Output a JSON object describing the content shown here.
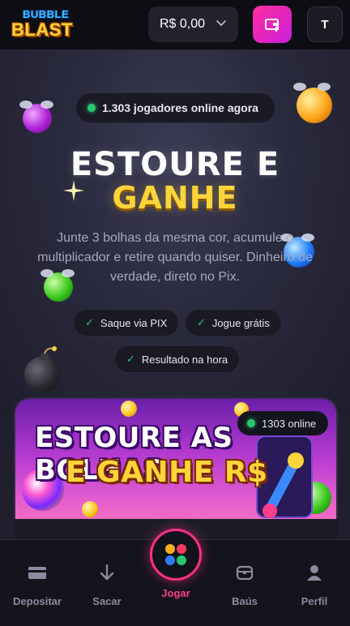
{
  "header": {
    "logo_top": "BUBBLE",
    "logo_bottom": "BLAST",
    "balance": "R$ 0,00",
    "avatar_initial": "T"
  },
  "hero": {
    "online_text": "1.303 jogadores online agora",
    "title_line1": "ESTOURE E",
    "title_line2": "GANHE",
    "subtitle": "Junte 3 bolhas da mesma cor, acumule o multiplicador e retire quando quiser. Dinheiro de verdade, direto no Pix.",
    "chips": [
      "Saque via PIX",
      "Jogue grátis",
      "Resultado na hora"
    ]
  },
  "banner": {
    "line1": "ESTOURE AS BOLHAS",
    "line2": "E GANHE R$",
    "online_badge": "1303 online"
  },
  "nav": {
    "items": [
      "Depositar",
      "Sacar",
      "Jogar",
      "Baús",
      "Perfil"
    ]
  },
  "colors": {
    "accent_pink": "#ff2f8a",
    "gold": "#ffd43b",
    "online_green": "#28c76f"
  }
}
